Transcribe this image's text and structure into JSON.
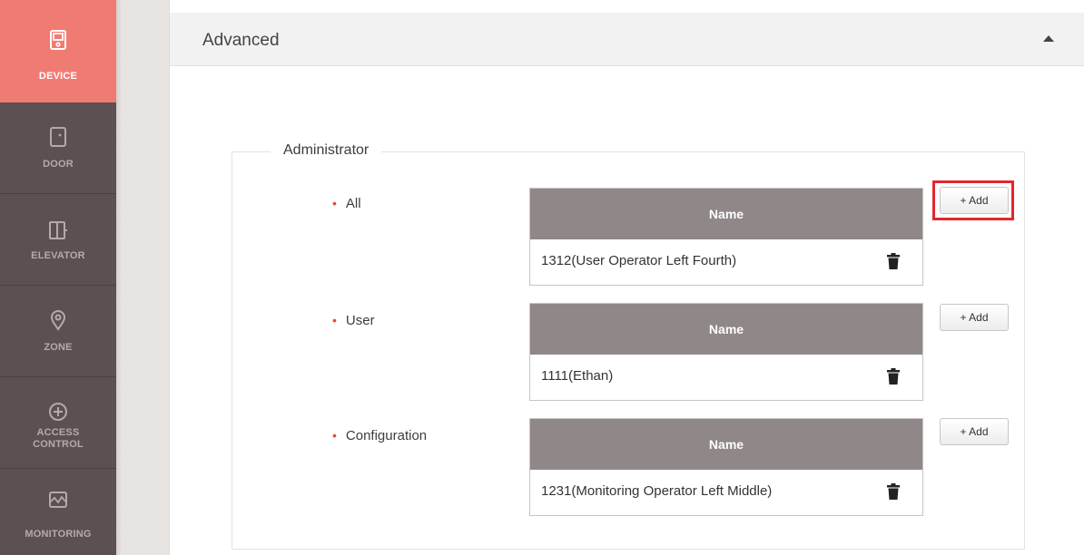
{
  "nav": {
    "items": [
      {
        "label": "DEVICE",
        "icon": "device-icon",
        "active": true
      },
      {
        "label": "DOOR",
        "icon": "door-icon"
      },
      {
        "label": "ELEVATOR",
        "icon": "elevator-icon"
      },
      {
        "label": "ZONE",
        "icon": "zone-icon"
      },
      {
        "label_line1": "ACCESS",
        "label_line2": "CONTROL",
        "icon": "access-control-icon"
      },
      {
        "label": "MONITORING",
        "icon": "monitoring-icon"
      }
    ]
  },
  "panel": {
    "title": "Advanced",
    "collapse_icon": "caret-up-icon"
  },
  "administrator": {
    "legend": "Administrator",
    "rows": [
      {
        "label": "All",
        "column_header": "Name",
        "entries": [
          "1312(User Operator Left Fourth)"
        ],
        "add_label": "+ Add"
      },
      {
        "label": "User",
        "column_header": "Name",
        "entries": [
          "1111(Ethan)"
        ],
        "add_label": "+ Add"
      },
      {
        "label": "Configuration",
        "column_header": "Name",
        "entries": [
          "1231(Monitoring Operator Left Middle)"
        ],
        "add_label": "+ Add"
      }
    ]
  },
  "colors": {
    "nav_bg": "#5d5052",
    "nav_active": "#f07b72",
    "table_header": "#8f8788",
    "highlight": "#e4262a",
    "bullet": "#e8433a"
  }
}
